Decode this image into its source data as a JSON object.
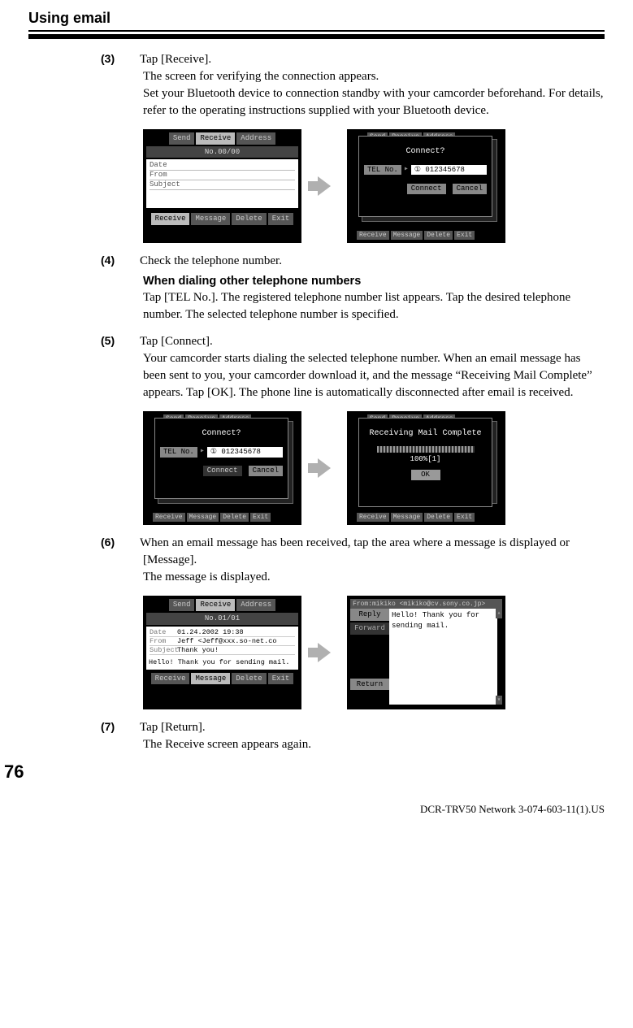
{
  "title": "Using email",
  "page_number": "76",
  "footer": "DCR-TRV50 Network 3-074-603-11(1).US",
  "steps": {
    "s3": {
      "num": "(3)",
      "l1": "Tap [Receive].",
      "l2": "The screen for verifying the connection appears.",
      "l3": "Set your Bluetooth device to connection standby with your camcorder beforehand. For details, refer to the operating instructions supplied with your Bluetooth device."
    },
    "s4": {
      "num": "(4)",
      "l1": "Check the telephone number.",
      "sub": "When dialing other telephone numbers",
      "l2": "Tap [TEL No.]. The registered telephone number list appears. Tap the desired telephone number. The selected telephone number is specified."
    },
    "s5": {
      "num": "(5)",
      "l1": "Tap [Connect].",
      "l2": "Your camcorder starts dialing the selected telephone number. When an email message has been sent to you, your camcorder download it, and the message “Receiving Mail Complete” appears. Tap [OK]. The phone line is automatically disconnected after email is received."
    },
    "s6": {
      "num": "(6)",
      "l1": "When an email message has been received, tap the area where a message is displayed or [Message].",
      "l2": "The message is displayed."
    },
    "s7": {
      "num": "(7)",
      "l1": "Tap [Return].",
      "l2": "The Receive screen appears again."
    }
  },
  "ui": {
    "tabs": {
      "send": "Send",
      "receive": "Receive",
      "address": "Address"
    },
    "bottom": {
      "receive": "Receive",
      "message": "Message",
      "delete": "Delete",
      "exit": "Exit"
    },
    "no_0": "No.00/00",
    "no_1": "No.01/01",
    "list_labels": {
      "date": "Date",
      "from": "From",
      "subject": "Subject"
    },
    "connect_q": "Connect?",
    "tel_label": "TEL No.",
    "tel_value": "① 012345678",
    "btn_connect": "Connect",
    "btn_cancel": "Cancel",
    "recv_complete": "Receiving Mail Complete",
    "pct": "100%[1]",
    "ok": "OK",
    "mail": {
      "date": "01.24.2002 19:38",
      "from": "Jeff <Jeff@xxx.so-net.co",
      "subject": "Thank you!",
      "body": "Hello! Thank you for sending mail."
    },
    "reader": {
      "from_header": "From:mikiko <mikiko@cv.sony.co.jp>",
      "reply": "Reply",
      "forward": "Forward",
      "return": "Return",
      "body": "Hello! Thank you for sending mail."
    }
  }
}
